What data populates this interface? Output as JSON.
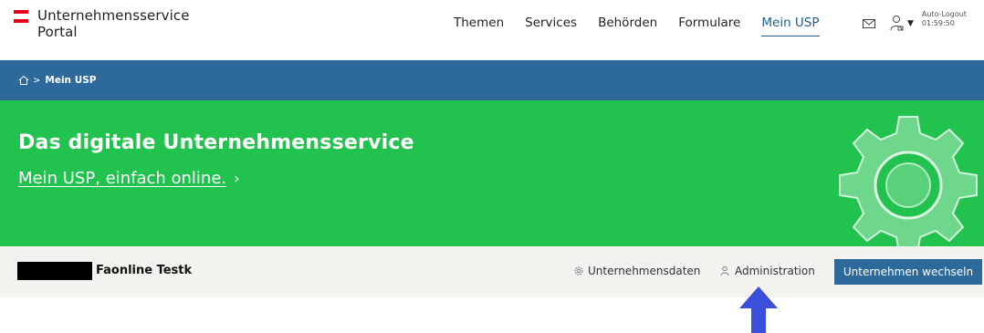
{
  "header": {
    "logo_line1": "Unternehmensservice",
    "logo_line2": "Portal",
    "nav": [
      {
        "label": "Themen",
        "active": false
      },
      {
        "label": "Services",
        "active": false
      },
      {
        "label": "Behörden",
        "active": false
      },
      {
        "label": "Formulare",
        "active": false
      },
      {
        "label": "Mein USP",
        "active": true
      }
    ],
    "autologout_label": "Auto-Logout",
    "autologout_time": "01:59:50"
  },
  "breadcrumb": {
    "separator": ">",
    "current": "Mein USP"
  },
  "banner": {
    "title": "Das digitale Unternehmensservice",
    "link": "Mein USP, einfach online.",
    "chevron": "›"
  },
  "company_bar": {
    "company_name": "Faonline Testk",
    "company_data_link": "Unternehmensdaten",
    "administration_link": "Administration",
    "switch_button": "Unternehmen wechseln"
  },
  "colors": {
    "primary_blue": "#2d6a9b",
    "banner_green": "#22c24e",
    "annotation_arrow": "#3b4fd8",
    "flag_red": "#e4001b"
  },
  "icons": [
    "mail-icon",
    "user-icon",
    "home-icon",
    "gear-icon",
    "admin-user-icon",
    "annotation-arrow"
  ]
}
